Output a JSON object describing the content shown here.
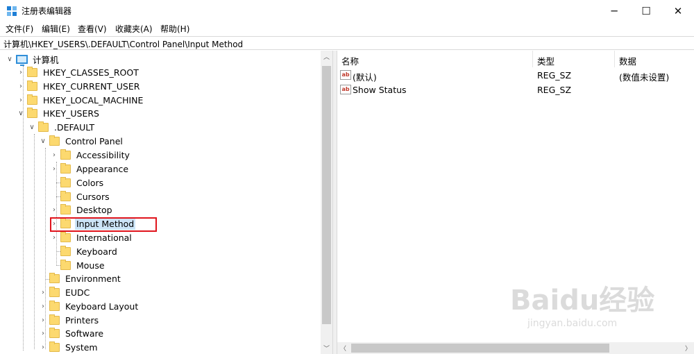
{
  "window": {
    "title": "注册表编辑器",
    "minimize": "─",
    "maximize": "☐",
    "close": "✕"
  },
  "menu": [
    "文件(F)",
    "编辑(E)",
    "查看(V)",
    "收藏夹(A)",
    "帮助(H)"
  ],
  "address": "计算机\\HKEY_USERS\\.DEFAULT\\Control Panel\\Input Method",
  "tree": [
    {
      "label": "计算机",
      "chevron": "∨",
      "icon": "computer-icon"
    },
    {
      "label": "HKEY_CLASSES_ROOT",
      "chevron": "›",
      "icon": "folder-icon"
    },
    {
      "label": "HKEY_CURRENT_USER",
      "chevron": "›",
      "icon": "folder-icon"
    },
    {
      "label": "HKEY_LOCAL_MACHINE",
      "chevron": "›",
      "icon": "folder-icon"
    },
    {
      "label": "HKEY_USERS",
      "chevron": "∨",
      "icon": "folder-icon"
    },
    {
      "label": ".DEFAULT",
      "chevron": "∨",
      "icon": "folder-icon"
    },
    {
      "label": "Control Panel",
      "chevron": "∨",
      "icon": "folder-icon"
    },
    {
      "label": "Accessibility",
      "chevron": "›",
      "icon": "folder-icon"
    },
    {
      "label": "Appearance",
      "chevron": "›",
      "icon": "folder-icon"
    },
    {
      "label": "Colors",
      "chevron": "",
      "icon": "folder-icon"
    },
    {
      "label": "Cursors",
      "chevron": "",
      "icon": "folder-icon"
    },
    {
      "label": "Desktop",
      "chevron": "›",
      "icon": "folder-icon"
    },
    {
      "label": "Input Method",
      "chevron": "›",
      "icon": "folder-icon",
      "selected": true
    },
    {
      "label": "International",
      "chevron": "›",
      "icon": "folder-icon"
    },
    {
      "label": "Keyboard",
      "chevron": "",
      "icon": "folder-icon"
    },
    {
      "label": "Mouse",
      "chevron": "",
      "icon": "folder-icon"
    },
    {
      "label": "Environment",
      "chevron": "",
      "icon": "folder-icon"
    },
    {
      "label": "EUDC",
      "chevron": "›",
      "icon": "folder-icon"
    },
    {
      "label": "Keyboard Layout",
      "chevron": "›",
      "icon": "folder-icon"
    },
    {
      "label": "Printers",
      "chevron": "›",
      "icon": "folder-icon"
    },
    {
      "label": "Software",
      "chevron": "›",
      "icon": "folder-icon"
    },
    {
      "label": "System",
      "chevron": "›",
      "icon": "folder-icon"
    }
  ],
  "list": {
    "columns": [
      "名称",
      "类型",
      "数据"
    ],
    "rows": [
      {
        "icon": "ab",
        "name": "(默认)",
        "type": "REG_SZ",
        "data": "(数值未设置)"
      },
      {
        "icon": "ab",
        "name": "Show Status",
        "type": "REG_SZ",
        "data": ""
      }
    ]
  },
  "scroll": {
    "up": "︿",
    "down": "﹀",
    "left": "〈",
    "right": "〉"
  },
  "watermark": {
    "main": "Baidu经验",
    "sub": "jingyan.baidu.com"
  },
  "colors": {
    "selection": "#cce4f7",
    "highlight_box": "#e0141c",
    "folder": "#fcd96f"
  }
}
